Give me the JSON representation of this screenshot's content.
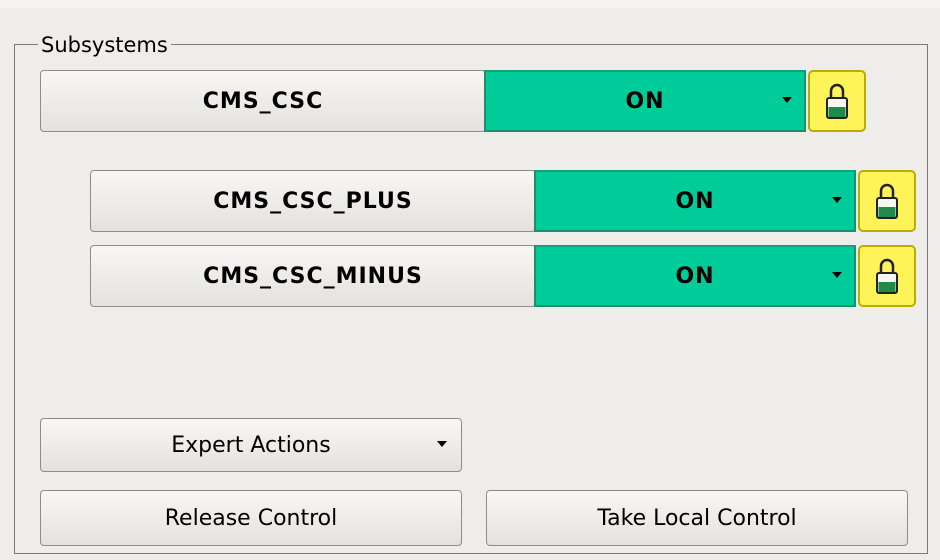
{
  "group": {
    "title": "Subsystems"
  },
  "subsystems": [
    {
      "name": "CMS_CSC",
      "state": "ON"
    },
    {
      "name": "CMS_CSC_PLUS",
      "state": "ON"
    },
    {
      "name": "CMS_CSC_MINUS",
      "state": "ON"
    }
  ],
  "actions": {
    "expert": "Expert Actions",
    "release": "Release Control",
    "take_local": "Take Local Control"
  },
  "colors": {
    "state_on": "#00cc99",
    "lock_bg": "#fff35a"
  },
  "icons": {
    "lock": "padlock-icon",
    "dropdown": "chevron-down-icon"
  }
}
